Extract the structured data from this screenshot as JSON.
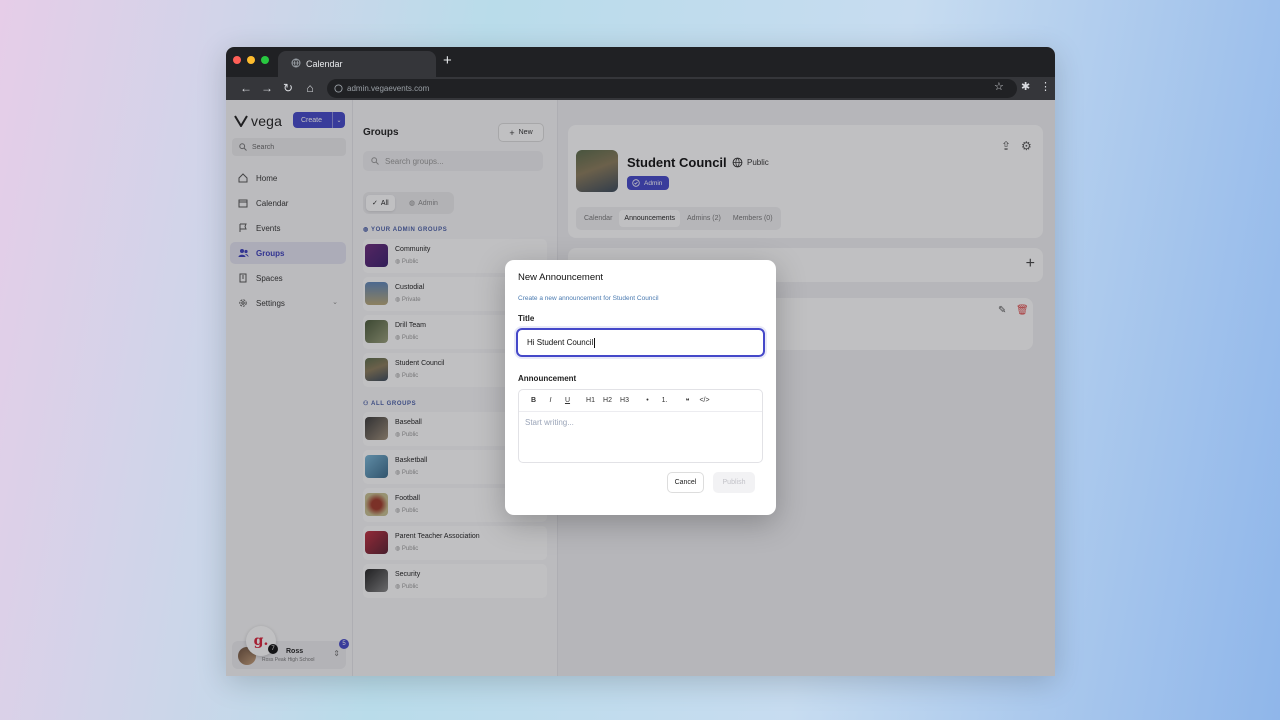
{
  "browser": {
    "tab_title": "Calendar",
    "new_tab": "+",
    "url": "admin.vegaevents.com"
  },
  "sidebar": {
    "logo": "vega",
    "create_label": "Create",
    "search_placeholder": "Search",
    "items": [
      {
        "label": "Home",
        "icon": "home-icon"
      },
      {
        "label": "Calendar",
        "icon": "calendar-icon"
      },
      {
        "label": "Events",
        "icon": "events-icon"
      },
      {
        "label": "Groups",
        "icon": "groups-icon",
        "active": true
      },
      {
        "label": "Spaces",
        "icon": "spaces-icon"
      },
      {
        "label": "Settings",
        "icon": "settings-icon"
      }
    ],
    "user": {
      "name": "Ross",
      "school": "Ross Peak High School",
      "badge": "5",
      "g_badge_count": "7",
      "g_logo": "g."
    }
  },
  "groups": {
    "title": "Groups",
    "new_label": "New",
    "search_placeholder": "Search groups...",
    "filters": {
      "all": "All",
      "admin": "Admin"
    },
    "admin_header": "YOUR ADMIN GROUPS",
    "all_header": "ALL GROUPS",
    "admin_groups": [
      {
        "name": "Community",
        "visibility": "Public"
      },
      {
        "name": "Custodial",
        "visibility": "Private"
      },
      {
        "name": "Drill Team",
        "visibility": "Public"
      },
      {
        "name": "Student Council",
        "visibility": "Public"
      }
    ],
    "all_groups": [
      {
        "name": "Baseball",
        "visibility": "Public"
      },
      {
        "name": "Basketball",
        "visibility": "Public"
      },
      {
        "name": "Football",
        "visibility": "Public"
      },
      {
        "name": "Parent Teacher Association",
        "visibility": "Public"
      },
      {
        "name": "Security",
        "visibility": "Public"
      }
    ]
  },
  "detail": {
    "title": "Student Council",
    "visibility": "Public",
    "role_badge": "Admin",
    "tabs": [
      "Calendar",
      "Announcements",
      "Admins (2)",
      "Members (0)"
    ],
    "active_tab": "Announcements"
  },
  "modal": {
    "title": "New Announcement",
    "description": "Create a new announcement for Student Council",
    "title_label": "Title",
    "title_value": "Hi Student Council",
    "announcement_label": "Announcement",
    "toolbar": [
      "B",
      "I",
      "U",
      "H1",
      "H2",
      "H3",
      "•",
      "1.",
      "❝",
      "</>"
    ],
    "editor_placeholder": "Start writing...",
    "cancel_label": "Cancel",
    "publish_label": "Publish"
  },
  "colors": {
    "accent": "#4548c9",
    "link": "#4a7ab0",
    "danger": "#e04545"
  }
}
